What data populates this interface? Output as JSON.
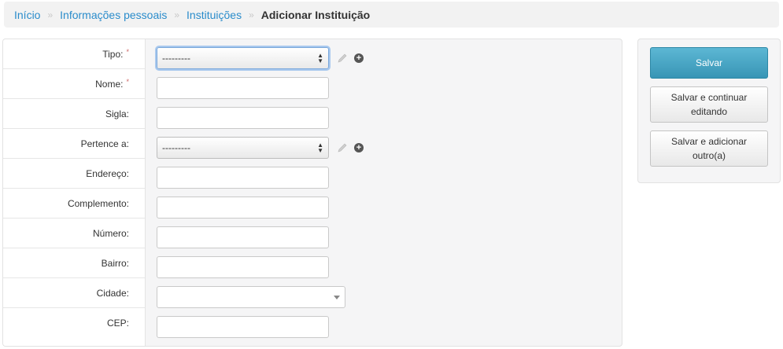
{
  "breadcrumb": {
    "items": [
      "Início",
      "Informações pessoais",
      "Instituições"
    ],
    "separator": "»",
    "current": "Adicionar Instituição"
  },
  "form": {
    "required_mark": "*",
    "fields": [
      {
        "label": "Tipo:",
        "type": "select",
        "value": "---------",
        "required": true
      },
      {
        "label": "Nome:",
        "type": "text",
        "value": "",
        "required": true
      },
      {
        "label": "Sigla:",
        "type": "text",
        "value": ""
      },
      {
        "label": "Pertence a:",
        "type": "select",
        "value": "---------"
      },
      {
        "label": "Endereço:",
        "type": "text",
        "value": ""
      },
      {
        "label": "Complemento:",
        "type": "text",
        "value": ""
      },
      {
        "label": "Número:",
        "type": "text",
        "value": ""
      },
      {
        "label": "Bairro:",
        "type": "text",
        "value": ""
      },
      {
        "label": "Cidade:",
        "type": "combo",
        "value": ""
      },
      {
        "label": "CEP:",
        "type": "text",
        "value": ""
      }
    ]
  },
  "actions": {
    "save": "Salvar",
    "save_continue": "Salvar e continuar editando",
    "save_add": "Salvar e adicionar outro(a)"
  },
  "colors": {
    "link": "#2a8ccb",
    "primary_button": "#48a6c5",
    "required": "#cc6666"
  }
}
